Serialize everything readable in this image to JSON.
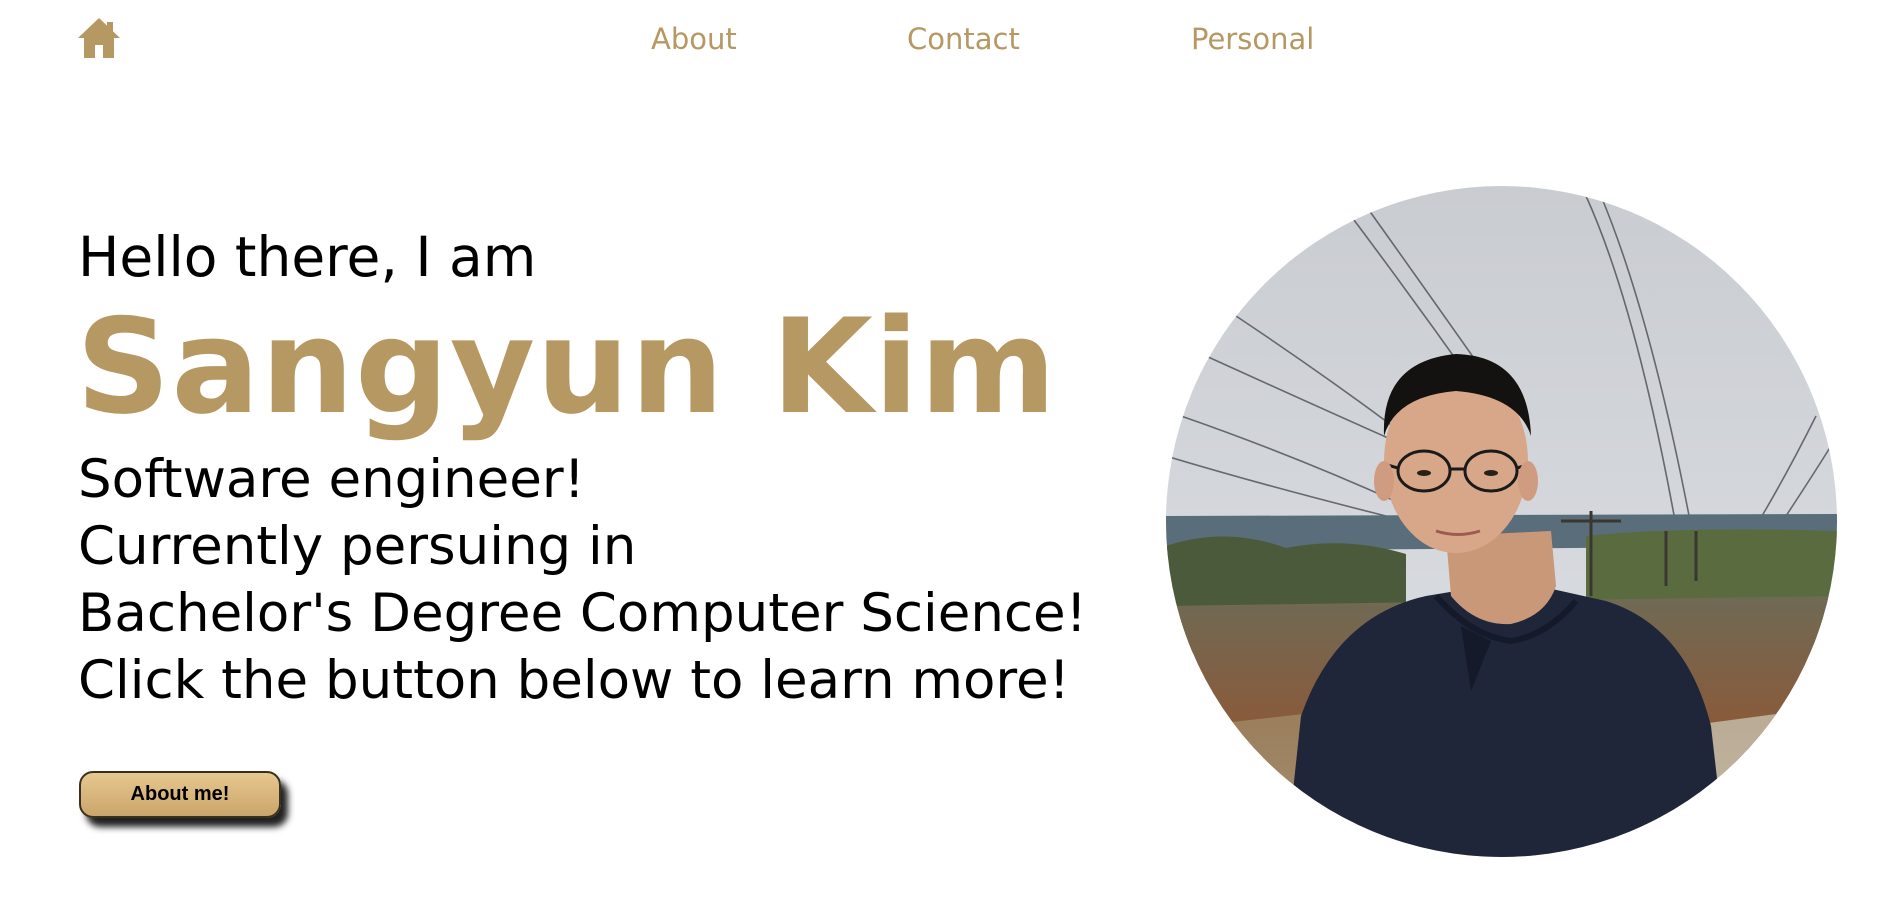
{
  "nav": {
    "home_icon": "home-icon",
    "links": [
      {
        "label": "About"
      },
      {
        "label": "Contact"
      },
      {
        "label": "Personal"
      }
    ]
  },
  "intro": {
    "greeting": "Hello there, I am",
    "name": "Sangyun Kim",
    "lines": [
      "Software engineer!",
      "Currently persuing in",
      "Bachelor's Degree Computer Science!",
      "Click the button below to learn more!"
    ],
    "button_label": "About me!"
  },
  "colors": {
    "accent": "#b59862",
    "text": "#000000",
    "button_top": "#e7c88f",
    "button_bottom": "#caa56a"
  }
}
